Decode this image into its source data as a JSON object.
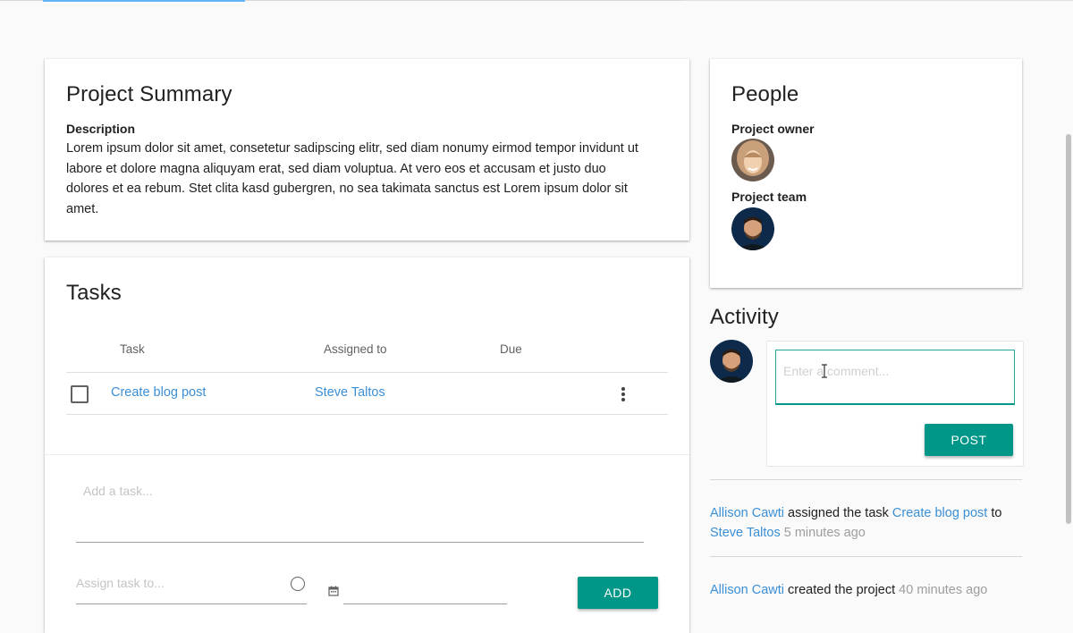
{
  "summary": {
    "title": "Project Summary",
    "description_label": "Description",
    "description_lines": [
      "Lorem ipsum dolor sit amet, consetetur sadipscing elitr, sed diam nonumy eirmod tempor invidunt ut",
      "labore et dolore magna aliquyam erat, sed diam voluptua. At vero eos et accusam et justo duo",
      "dolores et ea rebum. Stet clita kasd gubergren, no sea takimata sanctus est Lorem ipsum dolor sit",
      "amet."
    ]
  },
  "tasks": {
    "title": "Tasks",
    "columns": {
      "task": "Task",
      "assigned": "Assigned to",
      "due": "Due"
    },
    "rows": [
      {
        "task": "Create blog post",
        "assigned": "Steve Taltos",
        "due": ""
      }
    ],
    "add_task_placeholder": "Add a task...",
    "assign_placeholder": "Assign task to...",
    "add_button": "ADD"
  },
  "people": {
    "title": "People",
    "owner_label": "Project owner",
    "team_label": "Project team"
  },
  "activity": {
    "title": "Activity",
    "comment_placeholder": "Enter a comment...",
    "post_button": "POST",
    "entries": [
      {
        "actor": "Allison Cawti",
        "text1": " assigned the task ",
        "task": "Create blog post",
        "text2": " to",
        "target": "Steve Taltos",
        "time": " 5 minutes ago"
      },
      {
        "actor": "Allison Cawti",
        "text1": " created the project",
        "time": " 40 minutes ago"
      }
    ]
  },
  "colors": {
    "accent": "#009688",
    "link": "#3b8fd6",
    "top_accent": "#64b5f6"
  },
  "icons": [
    "more-vert-icon",
    "calendar-icon",
    "text-cursor-icon"
  ]
}
